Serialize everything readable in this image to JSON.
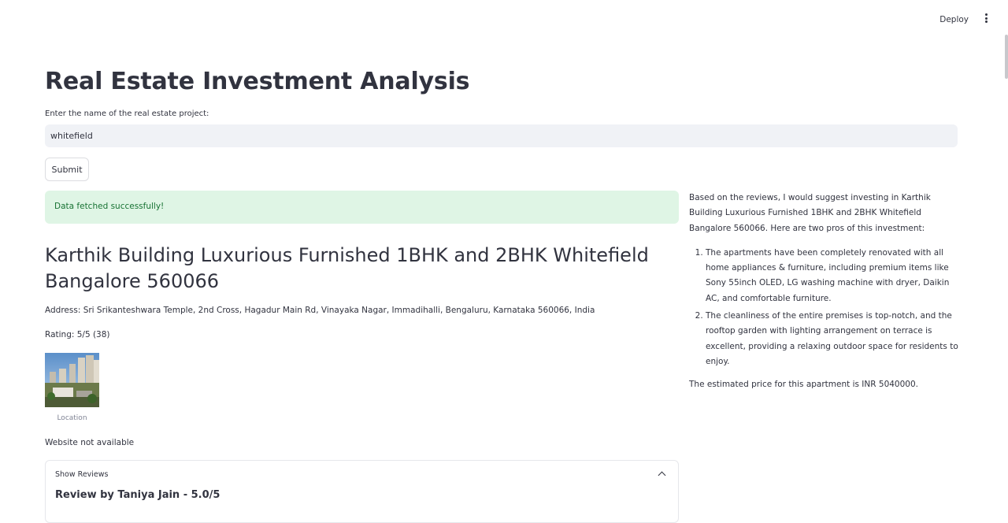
{
  "header": {
    "deploy_label": "Deploy",
    "menu_icon": "kebab-menu-icon"
  },
  "page": {
    "title": "Real Estate Investment Analysis",
    "input_label": "Enter the name of the real estate project:",
    "input_value": "whitefield",
    "submit_label": "Submit",
    "success_message": "Data fetched successfully!"
  },
  "project": {
    "name": "Karthik Building Luxurious Furnished 1BHK and 2BHK Whitefield Bangalore 560066",
    "address": "Address: Sri Srikanteshwara Temple, 2nd Cross, Hagadur Main Rd, Vinayaka Nagar, Immadihalli, Bengaluru, Karnataka 560066, India",
    "rating": "Rating: 5/5 (38)",
    "image_caption": "Location",
    "website": "Website not available"
  },
  "reviews": {
    "expander_label": "Show Reviews",
    "first_review_title": "Review by Taniya Jain - 5.0/5"
  },
  "analysis": {
    "intro": "Based on the reviews, I would suggest investing in Karthik Building Luxurious Furnished 1BHK and 2BHK Whitefield Bangalore 560066. Here are two pros of this investment:",
    "pros": [
      "The apartments have been completely renovated with all home appliances & furniture, including premium items like Sony 55inch OLED, LG washing machine with dryer, Daikin AC, and comfortable furniture.",
      "The cleanliness of the entire premises is top-notch, and the rooftop garden with lighting arrangement on terrace is excellent, providing a relaxing outdoor space for residents to enjoy."
    ],
    "price_text": "The estimated price for this apartment is INR 5040000."
  },
  "colors": {
    "text": "#31333f",
    "input_bg": "#f0f2f6",
    "success_bg": "#dff5e5",
    "success_text": "#177233"
  }
}
